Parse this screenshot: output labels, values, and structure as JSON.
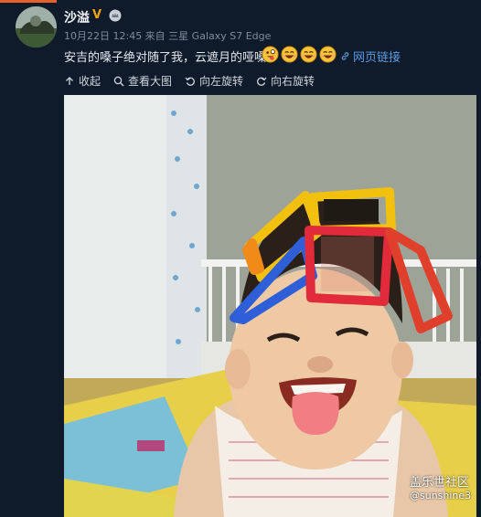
{
  "post": {
    "username": "沙溢",
    "vip_badge": "V",
    "meta": "10月22日 12:45 来自 三星 Galaxy S7 Edge",
    "text": "安吉的嗓子绝对随了我，云遮月的哑嗓",
    "link_label": "网页链接",
    "emojis": [
      "tongue-out-emoji",
      "laughing-emoji",
      "laughing-emoji",
      "laughing-emoji"
    ]
  },
  "toolbar": {
    "collapse": "收起",
    "view_large": "查看大图",
    "rotate_left": "向左旋转",
    "rotate_right": "向右旋转"
  },
  "photo": {
    "watermark_site": "盖乐世社区",
    "watermark_user": "@sunshine3"
  },
  "colors": {
    "background": "#0f1a2a",
    "accent_top": "#e7602a",
    "vip": "#f2a400",
    "link": "#5a9be0"
  }
}
